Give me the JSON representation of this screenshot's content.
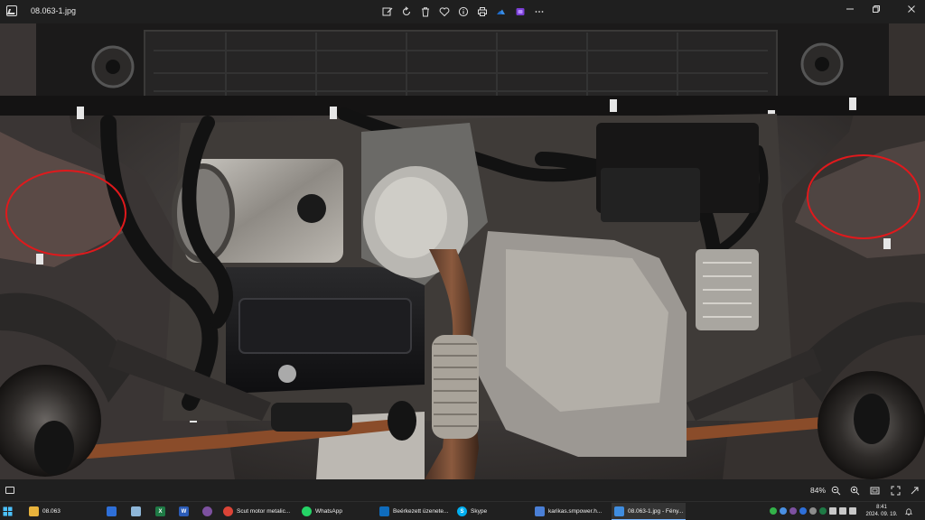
{
  "window": {
    "title": "08.063-1.jpg",
    "toolbar": [
      "edit-image-icon",
      "rotate-icon",
      "delete-icon",
      "favorite-icon",
      "info-icon",
      "print-icon",
      "onedrive-icon",
      "clipchamp-icon",
      "more-icon"
    ],
    "controls": [
      "minimize",
      "maximize",
      "close"
    ]
  },
  "statusbar": {
    "zoom": "84%"
  },
  "photo": {
    "annotations": [
      "left-red-ellipse",
      "right-red-ellipse"
    ],
    "annotation_color": "#e0191c"
  },
  "taskbar": {
    "items": [
      {
        "label": "08.063",
        "icon": "folder-icon",
        "color": "#e8b33c"
      },
      {
        "label": "",
        "icon": "teamviewer-icon",
        "color": "#2e6fd8"
      },
      {
        "label": "",
        "icon": "notepad-icon",
        "color": "#8fb7d9"
      },
      {
        "label": "",
        "icon": "excel-icon",
        "color": "#1e7a45"
      },
      {
        "label": "",
        "icon": "word-icon",
        "color": "#2b5cb8"
      },
      {
        "label": "",
        "icon": "viber-icon",
        "color": "#7d51a0"
      },
      {
        "label": "Scut motor metalic...",
        "icon": "chrome-icon",
        "color": "#db4437"
      },
      {
        "label": "WhatsApp",
        "icon": "whatsapp-icon",
        "color": "#25d366"
      },
      {
        "label": "Beérkezett üzenete...",
        "icon": "outlook-icon",
        "color": "#0f6cbd"
      },
      {
        "label": "Skype",
        "icon": "skype-icon",
        "color": "#00aff0"
      },
      {
        "label": "karikas.smpower.h...",
        "icon": "remote-desktop-icon",
        "color": "#4a7fd6"
      },
      {
        "label": "08.063-1.jpg - Fény...",
        "icon": "photos-icon",
        "color": "#3f8de0"
      }
    ],
    "clock": {
      "time": "8:41",
      "date": "2024. 09. 19."
    }
  }
}
